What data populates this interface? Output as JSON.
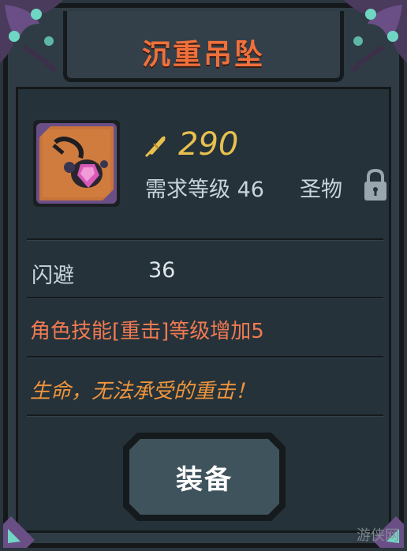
{
  "item": {
    "name": "沉重吊坠",
    "price": "290",
    "requirement": "需求等级 46",
    "rarity": "圣物",
    "stat_name": "闪避",
    "stat_value": "36",
    "effect": "角色技能[重击]等级增加5",
    "flavor_text": "生命，无法承受的重击！"
  },
  "actions": {
    "equip_label": "装备"
  },
  "watermark": "游侠网",
  "colors": {
    "title": "#f0703c",
    "price": "#e8c04e",
    "effect": "#f07a52",
    "flavor": "#f0953c",
    "panel": "#25323a"
  },
  "icons": {
    "price": "feather-currency-icon",
    "lock": "lock-icon",
    "item": "pendant-icon"
  }
}
